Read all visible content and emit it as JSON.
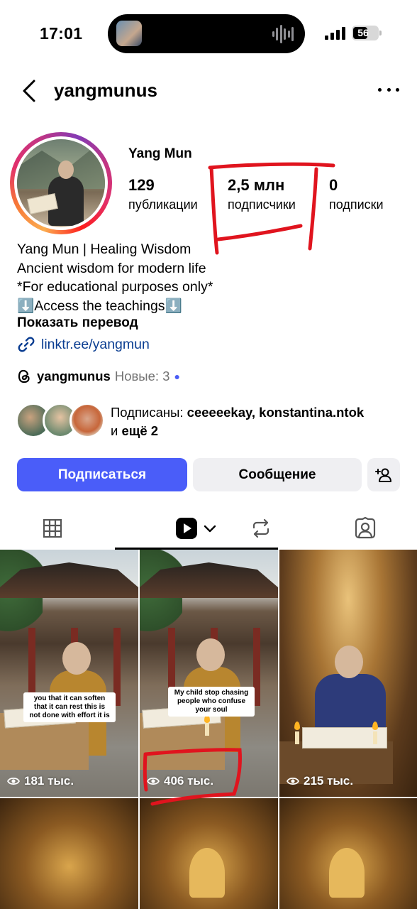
{
  "status_bar": {
    "time": "17:01",
    "battery": "56"
  },
  "header": {
    "username": "yangmunus"
  },
  "profile": {
    "display_name": "Yang Mun",
    "stats": [
      {
        "value": "129",
        "label": "публикации"
      },
      {
        "value": "2,5 млн",
        "label": "подписчики"
      },
      {
        "value": "0",
        "label": "подписки"
      }
    ],
    "bio": [
      "Yang Mun | Healing Wisdom",
      "Ancient wisdom for modern life",
      "*For educational purposes only*",
      "⬇️Access the teachings⬇️"
    ],
    "translate_label": "Показать перевод",
    "link": "linktr.ee/yangmun",
    "threads": {
      "name": "yangmunus",
      "new_label": "Новые: 3"
    },
    "followed_by": {
      "prefix": "Подписаны:",
      "names": "ceeeeekay, konstantina.ntok",
      "and": "и",
      "more": "ещё 2"
    }
  },
  "actions": {
    "follow": "Подписаться",
    "message": "Сообщение"
  },
  "tabs": [
    {
      "name": "grid",
      "icon": "grid-icon"
    },
    {
      "name": "reels",
      "icon": "reels-icon"
    },
    {
      "name": "reposts",
      "icon": "repost-icon"
    },
    {
      "name": "tagged",
      "icon": "tagged-icon"
    }
  ],
  "posts": [
    {
      "caption": "you that it can soften that it can rest this is not done with effort it is",
      "views": "181 тыс."
    },
    {
      "caption": "My child stop chasing people who confuse your soul",
      "views": "406 тыс."
    },
    {
      "caption": "",
      "views": "215 тыс."
    }
  ],
  "colors": {
    "follow_button": "#4a5df9",
    "link": "#0a3d91",
    "annotation": "#e0141e"
  }
}
